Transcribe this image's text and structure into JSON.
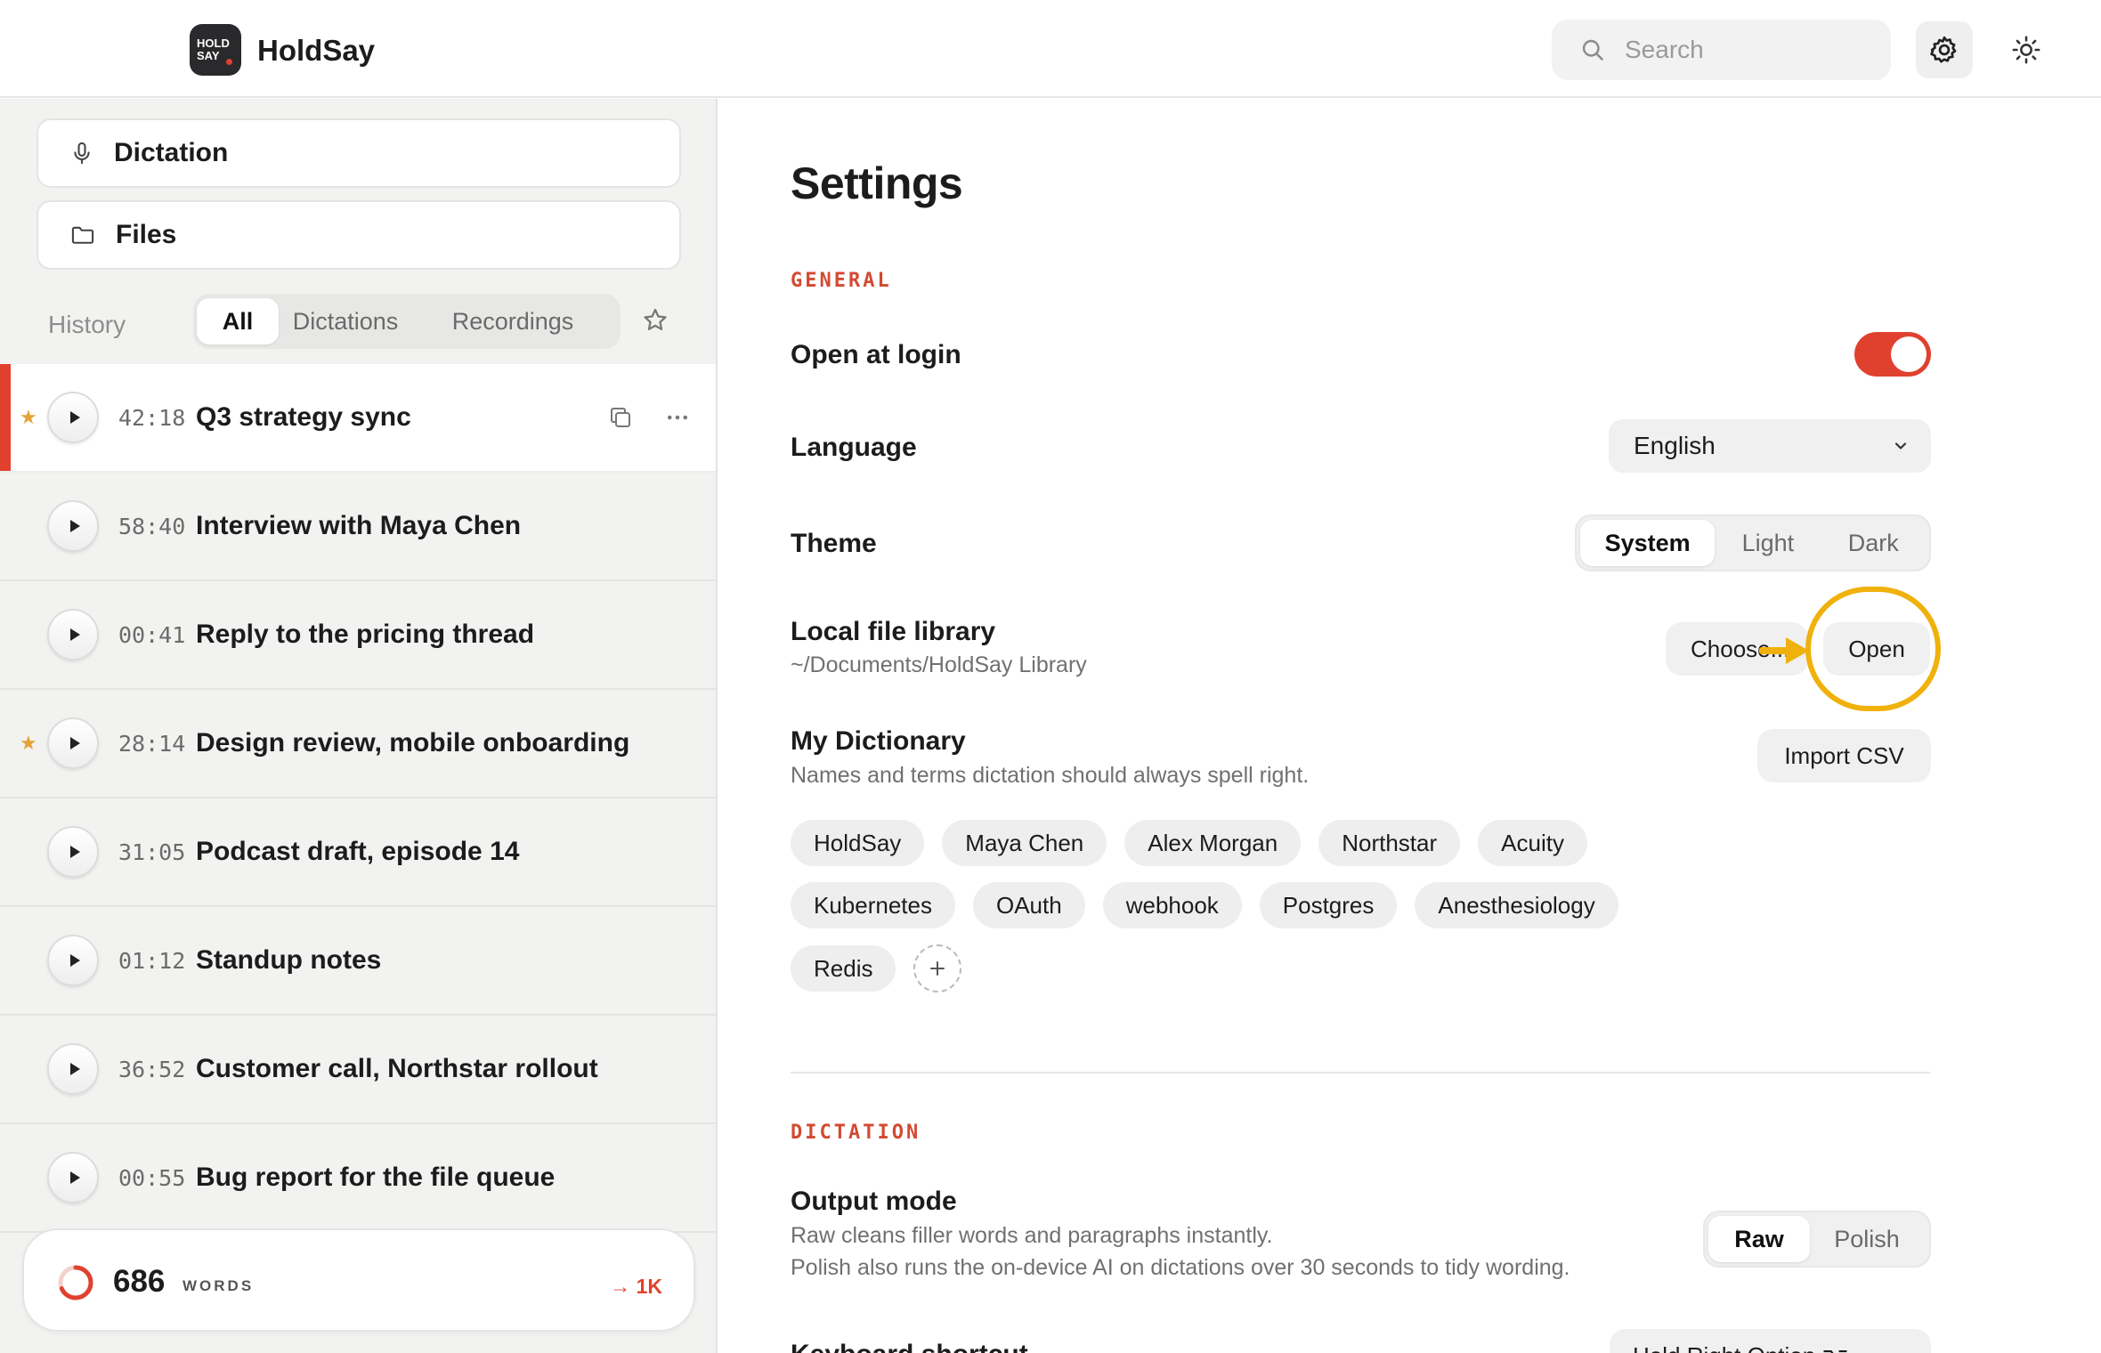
{
  "app": {
    "name": "HoldSay",
    "logo_text_1": "HOLD",
    "logo_text_2": "SAY"
  },
  "header": {
    "search_placeholder": "Search"
  },
  "sidebar": {
    "nav": [
      {
        "label": "Dictation"
      },
      {
        "label": "Files"
      }
    ],
    "history_label": "History",
    "filters": [
      {
        "label": "All"
      },
      {
        "label": "Dictations"
      },
      {
        "label": "Recordings"
      }
    ],
    "active_filter": "All",
    "items": [
      {
        "duration": "42:18",
        "title": "Q3 strategy sync",
        "starred": true,
        "selected": true
      },
      {
        "duration": "58:40",
        "title": "Interview with Maya Chen",
        "starred": false
      },
      {
        "duration": "00:41",
        "title": "Reply to the pricing thread",
        "starred": false
      },
      {
        "duration": "28:14",
        "title": "Design review, mobile onboarding",
        "starred": true
      },
      {
        "duration": "31:05",
        "title": "Podcast draft, episode 14",
        "starred": false
      },
      {
        "duration": "01:12",
        "title": "Standup notes",
        "starred": false
      },
      {
        "duration": "36:52",
        "title": "Customer call, Northstar rollout",
        "starred": false
      },
      {
        "duration": "00:55",
        "title": "Bug report for the file queue",
        "starred": false
      }
    ],
    "words": {
      "count": "686",
      "label": "WORDS",
      "goal": "→ 1K",
      "progress": 0.686
    }
  },
  "settings": {
    "title": "Settings",
    "general_label": "GENERAL",
    "open_at_login": {
      "label": "Open at login",
      "enabled": true
    },
    "language": {
      "label": "Language",
      "value": "English"
    },
    "theme": {
      "label": "Theme",
      "options": [
        "System",
        "Light",
        "Dark"
      ],
      "selected": "System"
    },
    "library": {
      "label": "Local file library",
      "path": "~/Documents/HoldSay Library",
      "choose_label": "Choose...",
      "open_label": "Open"
    },
    "dictionary": {
      "label": "My Dictionary",
      "description": "Names and terms dictation should always spell right.",
      "import_label": "Import CSV",
      "terms": [
        "HoldSay",
        "Maya Chen",
        "Alex Morgan",
        "Northstar",
        "Acuity",
        "Kubernetes",
        "OAuth",
        "webhook",
        "Postgres",
        "Anesthesiology",
        "Redis"
      ]
    },
    "dictation_label": "DICTATION",
    "output_mode": {
      "label": "Output mode",
      "desc_1": "Raw cleans filler words and paragraphs instantly.",
      "desc_2": "Polish also runs the on-device AI on dictations over 30 seconds to tidy wording.",
      "options": [
        "Raw",
        "Polish"
      ],
      "selected": "Raw"
    },
    "shortcut": {
      "label": "Keyboard shortcut",
      "value": "Hold Right Option ⌥"
    }
  },
  "colors": {
    "accent": "#e0412f",
    "highlight": "#f0b10c",
    "star": "#e3a23a"
  }
}
